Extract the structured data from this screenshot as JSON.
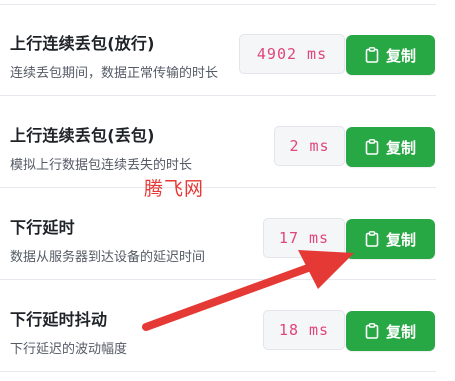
{
  "rows": [
    {
      "title": "上行连续丢包(放行)",
      "desc": "连续丢包期间，数据正常传输的时长",
      "value": "4902 ms",
      "copy_label": "复制"
    },
    {
      "title": "上行连续丢包(丢包)",
      "desc": "模拟上行数据包连续丢失的时长",
      "value": "2 ms",
      "copy_label": "复制"
    },
    {
      "title": "下行延时",
      "desc": "数据从服务器到达设备的延迟时间",
      "value": "17 ms",
      "copy_label": "复制"
    },
    {
      "title": "下行延时抖动",
      "desc": "下行延迟的波动幅度",
      "value": "18 ms",
      "copy_label": "复制"
    }
  ],
  "watermark": "腾飞网",
  "colors": {
    "copy_button": "#28a745",
    "value_text": "#e0457b",
    "arrow": "#e53935"
  },
  "icons": {
    "copy": "clipboard-icon"
  }
}
